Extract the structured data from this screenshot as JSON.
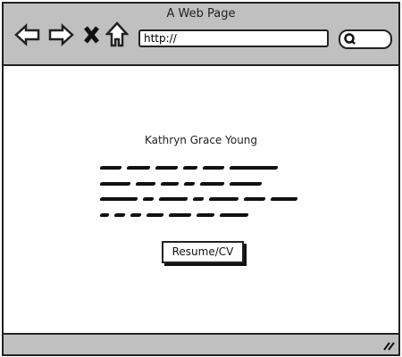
{
  "window": {
    "title": "A Web Page",
    "url": "http://",
    "search_icon": "search-icon"
  },
  "content": {
    "name": "Kathryn Grace Young",
    "button": "Resume/CV"
  },
  "colors": {
    "chrome": "#c0c0c0",
    "border": "#222222"
  }
}
